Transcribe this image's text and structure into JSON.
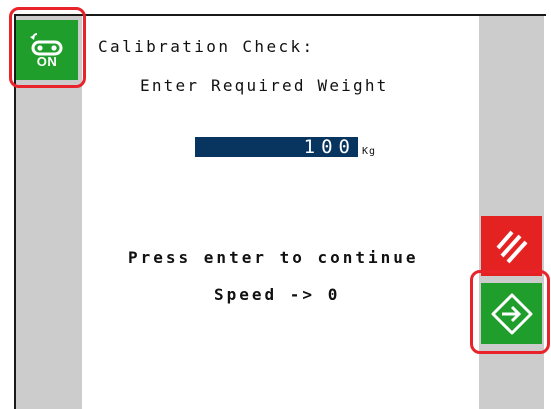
{
  "calibration": {
    "title": "Calibration Check:",
    "prompt": "Enter Required Weight",
    "weight_value": "100",
    "weight_unit": "Kg",
    "continue_text": "Press enter to continue",
    "speed_text": "Speed -> 0"
  },
  "softkeys": {
    "conveyor": {
      "label": "ON",
      "icon": "conveyor-belt-icon",
      "color": "#1f9e2c"
    },
    "stop": {
      "icon": "stop-hatch-icon",
      "color": "#e42222"
    },
    "enter": {
      "icon": "enter-arrow-icon",
      "color": "#1f9e2c"
    }
  },
  "colors": {
    "side_panels": "#cccccc",
    "input_background": "#083560",
    "highlight": "#e8232a"
  }
}
